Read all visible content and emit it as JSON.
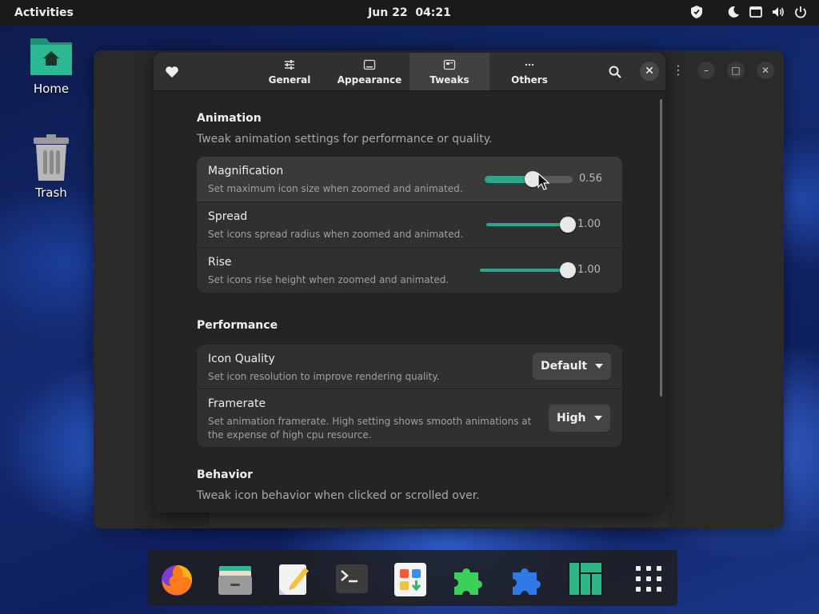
{
  "topbar": {
    "activities": "Activities",
    "date": "Jun 22",
    "time": "04:21"
  },
  "desktop": {
    "home_label": "Home",
    "trash_label": "Trash"
  },
  "dialog": {
    "tabs": [
      {
        "label": "General",
        "icon": "sliders-icon"
      },
      {
        "label": "Appearance",
        "icon": "window-icon"
      },
      {
        "label": "Tweaks",
        "icon": "tweaks-icon",
        "active": true
      },
      {
        "label": "Others",
        "icon": "more-icon"
      }
    ],
    "animation": {
      "title": "Animation",
      "subtitle": "Tweak animation settings for performance or quality.",
      "magnification": {
        "title": "Magnification",
        "desc": "Set maximum icon size when zoomed and animated.",
        "value": "0.56",
        "fraction": 0.56
      },
      "spread": {
        "title": "Spread",
        "desc": "Set icons spread radius when zoomed and animated.",
        "value": "1.00",
        "fraction": 1.0
      },
      "rise": {
        "title": "Rise",
        "desc": "Set icons rise height when zoomed and animated.",
        "value": "1.00",
        "fraction": 1.0
      }
    },
    "performance": {
      "title": "Performance",
      "icon_quality": {
        "title": "Icon Quality",
        "desc": "Set icon resolution to improve rendering quality.",
        "selected": "Default"
      },
      "framerate": {
        "title": "Framerate",
        "desc": "Set animation framerate. High setting shows smooth animations at the expense of high cpu resource.",
        "selected": "High"
      }
    },
    "behavior": {
      "title": "Behavior",
      "subtitle": "Tweak icon behavior when clicked or scrolled over."
    }
  },
  "dock": {
    "items": [
      "firefox-icon",
      "files-icon",
      "text-editor-icon",
      "terminal-icon",
      "software-icon",
      "extensions-icon",
      "extension-manager-icon",
      "manjaro-icon",
      "app-grid-icon"
    ]
  },
  "colors": {
    "accent": "#2fa58a",
    "panel": "#1a1a1a",
    "dialog_bg": "#242424",
    "card_bg": "#303030"
  }
}
